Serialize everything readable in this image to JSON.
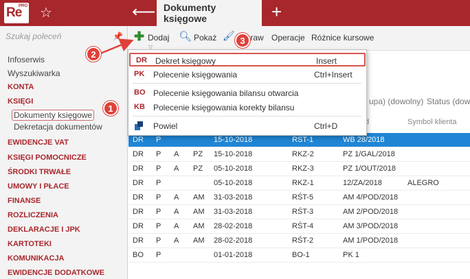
{
  "app": {
    "logo_text": "Re",
    "logo_sup": "PRO",
    "active_tab": "Dokumenty księgowe"
  },
  "icons": {
    "star": "star-icon",
    "back": "back-arrow-icon",
    "new_tab": "plus-icon",
    "pin": "pin-icon"
  },
  "colors": {
    "brand": "#a8272c",
    "selection": "#1f86d6",
    "callout": "#e0403a"
  },
  "sidebar": {
    "search_placeholder": "Szukaj poleceń",
    "items": [
      {
        "label": "Infoserwis",
        "kind": "plain"
      },
      {
        "label": "Wyszukiwarka",
        "kind": "plain"
      },
      {
        "label": "KONTA",
        "kind": "cat"
      },
      {
        "label": "KSIĘGI",
        "kind": "cat"
      },
      {
        "label": "Dokumenty księgowe",
        "kind": "sub"
      },
      {
        "label": "Dekretacja dokumentów",
        "kind": "sub"
      },
      {
        "label": "EWIDENCJE VAT",
        "kind": "cat"
      },
      {
        "label": "KSIĘGI POMOCNICZE",
        "kind": "cat"
      },
      {
        "label": "ŚRODKI TRWAŁE",
        "kind": "cat"
      },
      {
        "label": "UMOWY I PŁACE",
        "kind": "cat"
      },
      {
        "label": "FINANSE",
        "kind": "cat"
      },
      {
        "label": "ROZLICZENIA",
        "kind": "cat"
      },
      {
        "label": "DEKLARACJE I JPK",
        "kind": "cat"
      },
      {
        "label": "KARTOTEKI",
        "kind": "cat"
      },
      {
        "label": "KOMUNIKACJA",
        "kind": "cat"
      },
      {
        "label": "EWIDENCJE DODATKOWE",
        "kind": "cat"
      }
    ]
  },
  "toolbar": {
    "add_label": "Dodaj",
    "show_label": "Pokaż",
    "edit_label": "Popraw",
    "operations_label": "Operacje",
    "fx_label": "Różnice kursowe"
  },
  "filters": {
    "group_hint": "upa) (dowolny)",
    "status_hint": "Status (dowo"
  },
  "columns": {
    "doc_number_hint": "d",
    "client_symbol": "Symbol klienta"
  },
  "dropdown": {
    "items": [
      {
        "code": "DR",
        "label": "Dekret księgowy",
        "shortcut": "Insert"
      },
      {
        "code": "PK",
        "label": "Polecenie księgowania",
        "shortcut": "Ctrl+Insert"
      },
      {
        "code": "BO",
        "label": "Polecenie księgowania bilansu otwarcia",
        "shortcut": ""
      },
      {
        "code": "KB",
        "label": "Polecenie księgowania korekty bilansu",
        "shortcut": ""
      },
      {
        "code": "",
        "label": "Powiel",
        "shortcut": "Ctrl+D",
        "icon": "duplicate-icon"
      }
    ]
  },
  "rows": [
    {
      "c1": "DR",
      "c2": "P",
      "c3": "",
      "c4": "",
      "date": "15-10-2018",
      "reg": "RST-1",
      "doc": "WB 28/2018",
      "client": ""
    },
    {
      "c1": "DR",
      "c2": "P",
      "c3": "A",
      "c4": "PZ",
      "date": "15-10-2018",
      "reg": "RKZ-2",
      "doc": "PZ 1/GAL/2018",
      "client": ""
    },
    {
      "c1": "DR",
      "c2": "P",
      "c3": "A",
      "c4": "PZ",
      "date": "05-10-2018",
      "reg": "RKZ-3",
      "doc": "PZ 1/OUT/2018",
      "client": ""
    },
    {
      "c1": "DR",
      "c2": "P",
      "c3": "",
      "c4": "",
      "date": "05-10-2018",
      "reg": "RKZ-1",
      "doc": "12/ZA/2018",
      "client": "ALEGRO"
    },
    {
      "c1": "DR",
      "c2": "P",
      "c3": "A",
      "c4": "AM",
      "date": "31-03-2018",
      "reg": "RŚT-5",
      "doc": "AM 4/POD/2018",
      "client": ""
    },
    {
      "c1": "DR",
      "c2": "P",
      "c3": "A",
      "c4": "AM",
      "date": "31-03-2018",
      "reg": "RŚT-3",
      "doc": "AM 2/POD/2018",
      "client": ""
    },
    {
      "c1": "DR",
      "c2": "P",
      "c3": "A",
      "c4": "AM",
      "date": "28-02-2018",
      "reg": "RŚT-4",
      "doc": "AM 3/POD/2018",
      "client": ""
    },
    {
      "c1": "DR",
      "c2": "P",
      "c3": "A",
      "c4": "AM",
      "date": "28-02-2018",
      "reg": "RŚT-2",
      "doc": "AM 1/POD/2018",
      "client": ""
    },
    {
      "c1": "BO",
      "c2": "P",
      "c3": "",
      "c4": "",
      "date": "01-01-2018",
      "reg": "BO-1",
      "doc": "PK 1",
      "client": ""
    }
  ],
  "callouts": {
    "one": "1",
    "two": "2",
    "three": "3"
  }
}
